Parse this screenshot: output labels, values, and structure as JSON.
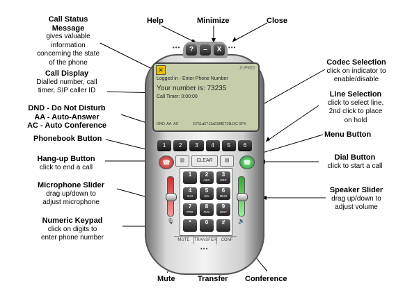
{
  "annotations": {
    "help": "Help",
    "minimize": "Minimize",
    "close": "Close",
    "call_status": {
      "title": "Call Status",
      "title2": "Message",
      "lines": [
        "gives valuable",
        "information",
        "concerning the state",
        "of the phone"
      ]
    },
    "call_display": {
      "title": "Call Display",
      "lines": [
        "Dialled number, call",
        "timer, SIP caller ID"
      ]
    },
    "dnd": {
      "line1": "DND - Do Not   Disturb",
      "line2": "AA - Auto-Answer",
      "line3": "AC - Auto Conference"
    },
    "phonebook": "Phonebook Button",
    "hangup": {
      "title": "Hang-up Button",
      "desc": "click to end a call"
    },
    "mic": {
      "title": "Microphone Slider",
      "lines": [
        "drag up/down to",
        "adjust microphone"
      ]
    },
    "keypad": {
      "title": "Numeric Keypad",
      "lines": [
        "click on digits to",
        "enter phone number"
      ]
    },
    "codec": {
      "title": "Codec Selection",
      "lines": [
        "click on indicator to",
        "enable/disable"
      ]
    },
    "line_sel": {
      "title": "Line Selection",
      "lines": [
        "click to select line,",
        "2nd click to place",
        "on hold"
      ]
    },
    "menu": "Menu Button",
    "dial": {
      "title": "Dial Button",
      "desc": "click to start a call"
    },
    "speaker": {
      "title": "Speaker Slider",
      "lines": [
        "drag up/down to",
        "adjust volume"
      ]
    },
    "mute": "Mute",
    "transfer": "Transfer",
    "conference": "Conference"
  },
  "phone": {
    "top_buttons": [
      "?",
      "–",
      "X"
    ],
    "logo_glyph": "✕",
    "brand": "X-PRO",
    "status_message": "Logged in - Enter Phone Number",
    "display_number": "Your number is: 73235",
    "call_timer": "Call Timer: 0:00:00",
    "indicators": [
      "DND",
      "AA",
      "AC"
    ],
    "codecs": [
      "G711u",
      "G711a",
      "GSM",
      "G729",
      "LDC",
      "SPX"
    ],
    "line_buttons": [
      "1",
      "2",
      "3",
      "4",
      "5",
      "6"
    ],
    "clear_label": "CLEAR",
    "keys": [
      {
        "digit": "1",
        "letters": ""
      },
      {
        "digit": "2",
        "letters": "ABC"
      },
      {
        "digit": "3",
        "letters": "DEF"
      },
      {
        "digit": "4",
        "letters": "GHI"
      },
      {
        "digit": "5",
        "letters": "JKL"
      },
      {
        "digit": "6",
        "letters": "MNO"
      },
      {
        "digit": "7",
        "letters": "PRS"
      },
      {
        "digit": "8",
        "letters": "TUV"
      },
      {
        "digit": "9",
        "letters": "WXY"
      },
      {
        "digit": "*",
        "letters": ""
      },
      {
        "digit": "0",
        "letters": ""
      },
      {
        "digit": "#",
        "letters": ""
      }
    ],
    "bottom_buttons": [
      "MUTE",
      "TRANSFER",
      "CONF"
    ],
    "mic_level": 0.5,
    "speaker_level": 0.5,
    "colors": {
      "screen": "#c5cdaa",
      "hangup": "#c03030",
      "dial": "#2a9a3a"
    }
  }
}
